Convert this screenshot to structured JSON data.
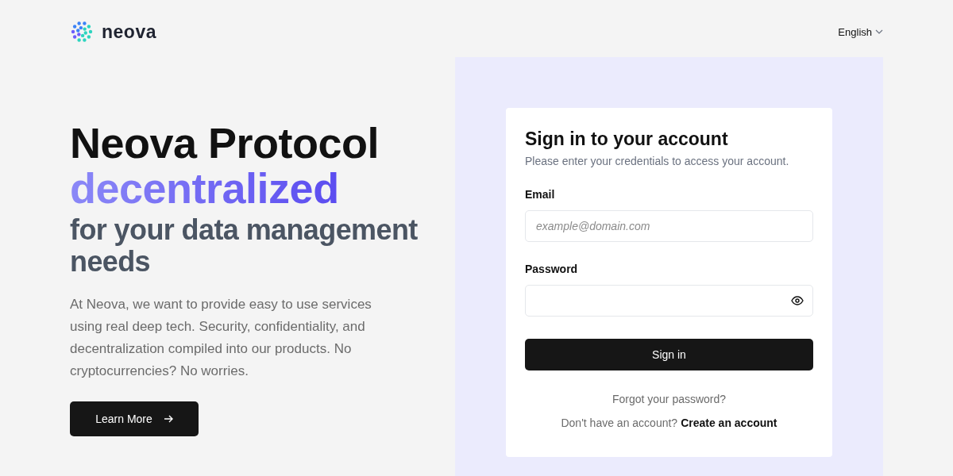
{
  "header": {
    "brand": "neova",
    "language": "English"
  },
  "hero": {
    "title": "Neova Protocol",
    "highlight": "decentralized",
    "subtitle": "for your data management needs",
    "description": "At Neova, we want to provide easy to use services using real deep tech. Security, confidentiality, and decentralization compiled into our products. No cryptocurrencies? No worries.",
    "button": "Learn More"
  },
  "signin": {
    "title": "Sign in to your account",
    "subtitle": "Please enter your credentials to access your account.",
    "fields": [
      {
        "label": "Email",
        "placeholder": "example@domain.com",
        "kind": "text"
      },
      {
        "label": "Password",
        "kind": "password"
      }
    ],
    "button": "Sign in",
    "forgot": "Forgot your password?",
    "signup_prompt": "Don't have an account?",
    "signup_link": "Create an account"
  }
}
